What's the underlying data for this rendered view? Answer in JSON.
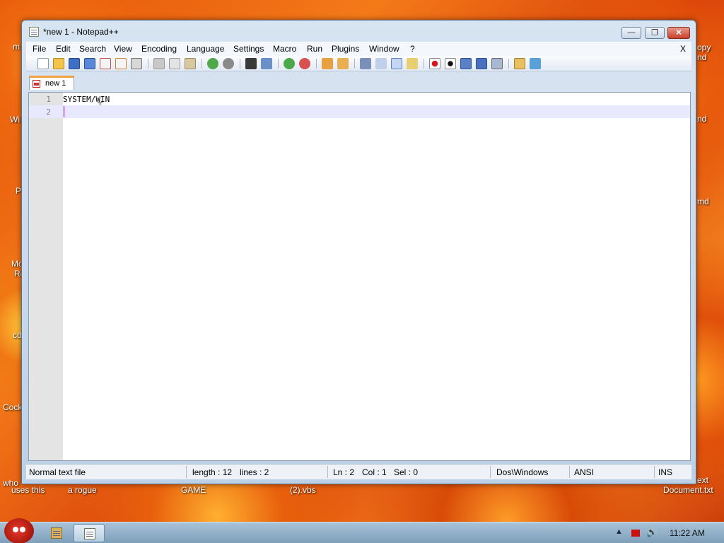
{
  "window": {
    "title": "*new 1 - Notepad++"
  },
  "title_buttons": {
    "minimize": "—",
    "maximize": "❐",
    "close": "✕"
  },
  "menu": {
    "items": [
      "File",
      "Edit",
      "Search",
      "View",
      "Encoding",
      "Language",
      "Settings",
      "Macro",
      "Run",
      "Plugins",
      "Window",
      "?"
    ],
    "close_doc": "X"
  },
  "toolbar": {
    "buttons": [
      "new",
      "open",
      "save",
      "save-all",
      "close",
      "close-all",
      "print",
      "cut",
      "copy",
      "paste",
      "undo",
      "redo",
      "find",
      "replace",
      "zoom-in",
      "zoom-out",
      "sync-vertical",
      "sync-horizontal",
      "word-wrap",
      "show-all-chars",
      "indent-guide",
      "user-defined-language",
      "record-macro",
      "stop-recording",
      "playback-macro",
      "run-macro-multiple",
      "save-macro",
      "open-folder",
      "spell-check"
    ]
  },
  "tabs": [
    {
      "label": "new  1"
    }
  ],
  "editor": {
    "lines": [
      {
        "number": "1",
        "text": "SYSTEM/WIN"
      },
      {
        "number": "2",
        "text": ""
      }
    ]
  },
  "status": {
    "file_type": "Normal text file",
    "length": "length : 12",
    "lines": "lines : 2",
    "ln": "Ln : 2",
    "col": "Col : 1",
    "sel": "Sel : 0",
    "eol": "Dos\\Windows",
    "encoding": "ANSI",
    "mode": "INS"
  },
  "desktop": {
    "labels": [
      "who",
      "uses this",
      "a rogue",
      "GAME",
      "(2).vbs",
      "ext",
      "Document.txt",
      "Cock",
      "cd",
      "Mo",
      "Re",
      "P",
      "Wi",
      "m",
      "opy",
      "nd",
      "nd",
      "md"
    ]
  },
  "taskbar": {
    "time": "11:22 AM",
    "tray_arrow": "▲",
    "speaker": "🔊"
  }
}
